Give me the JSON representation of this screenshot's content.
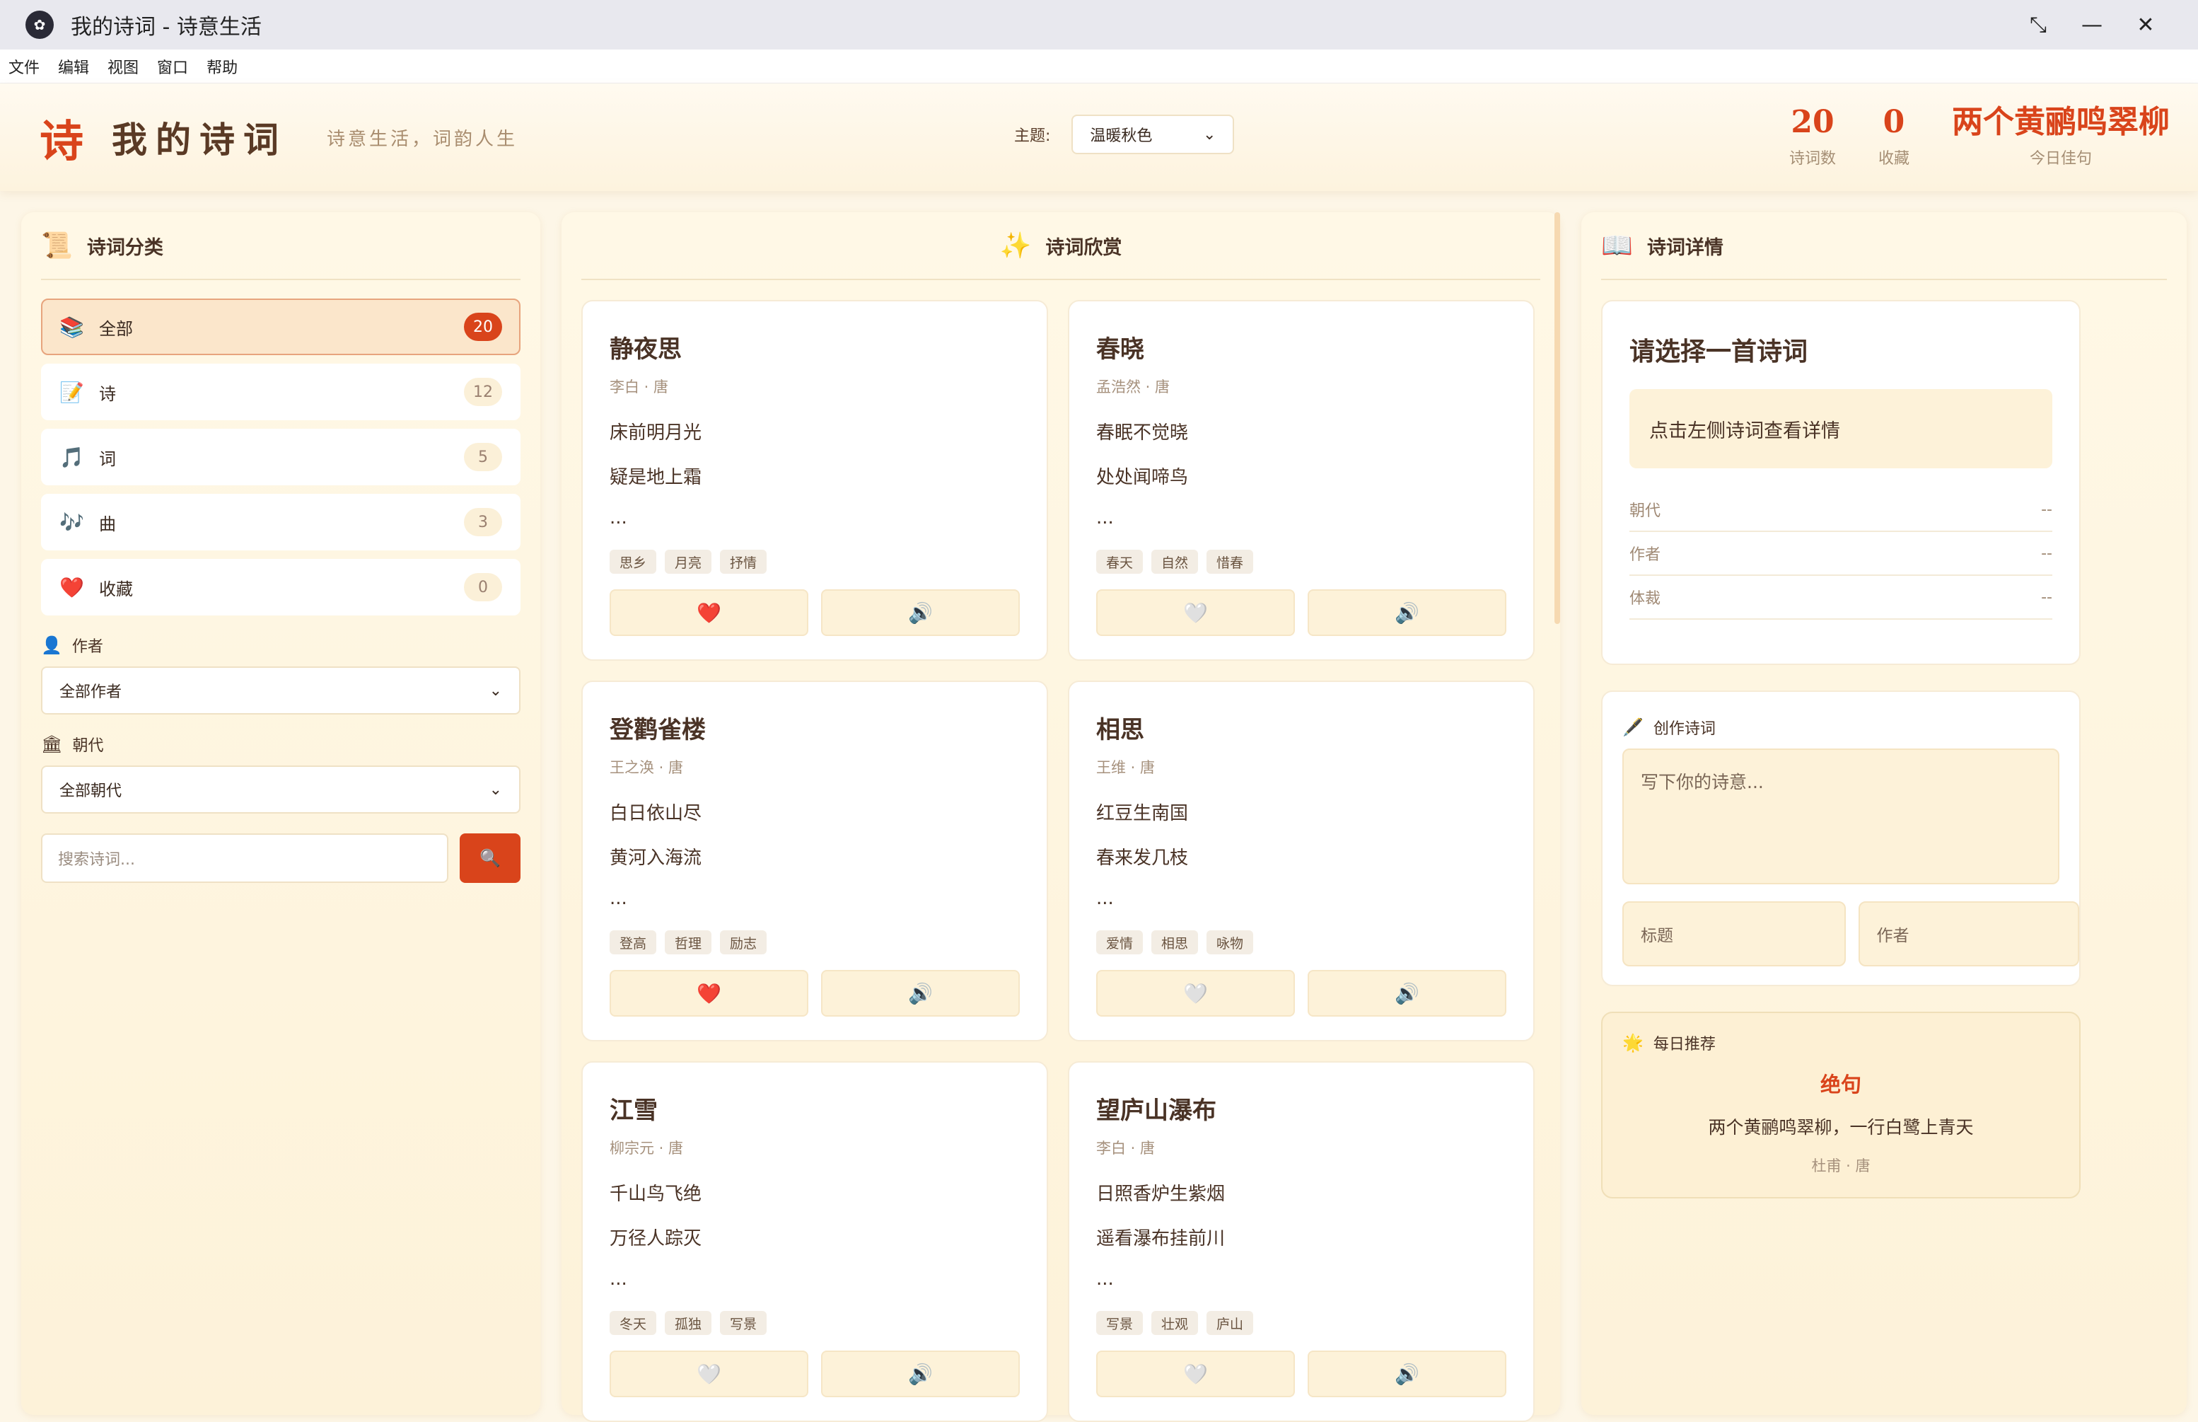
{
  "window": {
    "title": "我的诗词 - 诗意生活",
    "controls": [
      "⤡",
      "—",
      "✕"
    ]
  },
  "menu": [
    "文件",
    "编辑",
    "视图",
    "窗口",
    "帮助"
  ],
  "header": {
    "logo_char": "诗",
    "brand": "我的诗词",
    "slogan": "诗意生活，词韵人生",
    "theme_label": "主题:",
    "theme_value": "温暖秋色",
    "stats": [
      {
        "num": "20",
        "cap": "诗词数"
      },
      {
        "num": "0",
        "cap": "收藏"
      },
      {
        "num": "两个黄鹂鸣翠柳",
        "cap": "今日佳句"
      }
    ]
  },
  "left": {
    "title": "诗词分类",
    "title_icon": "📜",
    "categories": [
      {
        "icon": "📚",
        "label": "全部",
        "count": "20"
      },
      {
        "icon": "📝",
        "label": "诗",
        "count": "12"
      },
      {
        "icon": "🎵",
        "label": "词",
        "count": "5"
      },
      {
        "icon": "🎶",
        "label": "曲",
        "count": "3"
      },
      {
        "icon": "❤️",
        "label": "收藏",
        "count": "0"
      }
    ],
    "author_label": "作者",
    "author_value": "全部作者",
    "dynasty_label": "朝代",
    "dynasty_value": "全部朝代",
    "search_placeholder": "搜索诗词...",
    "search_btn": "🔍"
  },
  "center": {
    "title": "诗词欣赏",
    "title_icon": "✨",
    "poems": [
      {
        "title": "静夜思",
        "meta": "李白 · 唐",
        "lines": [
          "床前明月光",
          "疑是地上霜",
          "..."
        ],
        "tags": [
          "思乡",
          "月亮",
          "抒情"
        ],
        "fav": "❤️",
        "speak": "🔊"
      },
      {
        "title": "春晓",
        "meta": "孟浩然 · 唐",
        "lines": [
          "春眠不觉晓",
          "处处闻啼鸟",
          "..."
        ],
        "tags": [
          "春天",
          "自然",
          "惜春"
        ],
        "fav": "🤍",
        "speak": "🔊"
      },
      {
        "title": "登鹳雀楼",
        "meta": "王之涣 · 唐",
        "lines": [
          "白日依山尽",
          "黄河入海流",
          "..."
        ],
        "tags": [
          "登高",
          "哲理",
          "励志"
        ],
        "fav": "❤️",
        "speak": "🔊"
      },
      {
        "title": "相思",
        "meta": "王维 · 唐",
        "lines": [
          "红豆生南国",
          "春来发几枝",
          "..."
        ],
        "tags": [
          "爱情",
          "相思",
          "咏物"
        ],
        "fav": "🤍",
        "speak": "🔊"
      },
      {
        "title": "江雪",
        "meta": "柳宗元 · 唐",
        "lines": [
          "千山鸟飞绝",
          "万径人踪灭",
          "..."
        ],
        "tags": [
          "冬天",
          "孤独",
          "写景"
        ],
        "fav": "🤍",
        "speak": "🔊"
      },
      {
        "title": "望庐山瀑布",
        "meta": "李白 · 唐",
        "lines": [
          "日照香炉生紫烟",
          "遥看瀑布挂前川",
          "..."
        ],
        "tags": [
          "写景",
          "壮观",
          "庐山"
        ],
        "fav": "🤍",
        "speak": "🔊"
      }
    ]
  },
  "right": {
    "title": "诗词详情",
    "title_icon": "📖",
    "detail_title": "请选择一首诗词",
    "detail_hint": "点击左侧诗词查看详情",
    "rows": [
      {
        "k": "朝代",
        "v": "--"
      },
      {
        "k": "作者",
        "v": "--"
      },
      {
        "k": "体裁",
        "v": "--"
      }
    ],
    "compose_label": "创作诗词",
    "compose_icon": "🖋️",
    "compose_placeholder": "写下你的诗意...",
    "compose_title_ph": "标题",
    "compose_author_ph": "作者",
    "daily_label": "每日推荐",
    "daily_icon": "🌟",
    "daily_title": "绝句",
    "daily_quote": "两个黄鹂鸣翠柳，一行白鹭上青天",
    "daily_author": "杜甫 · 唐"
  }
}
